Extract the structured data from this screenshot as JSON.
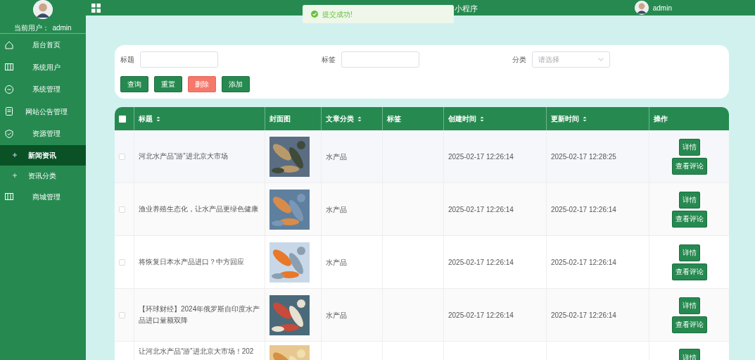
{
  "sidebar": {
    "user_label": "当前用户：",
    "user_name": "admin",
    "items": [
      {
        "label": "后台首页",
        "selected": false
      },
      {
        "label": "系统用户",
        "selected": false
      },
      {
        "label": "系统管理",
        "selected": false
      },
      {
        "label": "网站公告管理",
        "selected": false
      },
      {
        "label": "资源管理",
        "selected": false,
        "children": [
          {
            "label": "新闻资讯",
            "selected": true
          },
          {
            "label": "资讯分类",
            "selected": false
          }
        ]
      },
      {
        "label": "商城管理",
        "selected": false
      }
    ]
  },
  "header": {
    "title": "小程序",
    "user": "admin"
  },
  "toast": {
    "message": "提交成功!"
  },
  "search": {
    "fields": [
      {
        "label": "标题",
        "kind": "text"
      },
      {
        "label": "标签",
        "kind": "text"
      },
      {
        "label": "分类",
        "kind": "select",
        "placeholder": "请选择"
      }
    ],
    "buttons": [
      {
        "label": "查询",
        "kind": "primary"
      },
      {
        "label": "重置",
        "kind": "primary"
      },
      {
        "label": "删除",
        "kind": "danger"
      },
      {
        "label": "添加",
        "kind": "primary"
      }
    ]
  },
  "table": {
    "all_checked": false,
    "columns": [
      {
        "label": "标题",
        "sortable": true
      },
      {
        "label": "封面图",
        "sortable": false
      },
      {
        "label": "文章分类",
        "sortable": true
      },
      {
        "label": "标签",
        "sortable": false
      },
      {
        "label": "创建时间",
        "sortable": true
      },
      {
        "label": "更新时间",
        "sortable": true
      },
      {
        "label": "操作",
        "sortable": false
      }
    ],
    "rows": [
      {
        "checked": false,
        "title": "河北水产品“游”进北京大市场",
        "category": "水产品",
        "created": "2025-02-17 12:26:14",
        "updated": "2025-02-17 12:28:25",
        "actions": [
          "详情",
          "查看评论"
        ]
      },
      {
        "checked": false,
        "title": "渔业养殖生态化，让水产品更绿色健康",
        "category": "水产品",
        "created": "2025-02-17 12:26:14",
        "updated": "2025-02-17 12:26:14",
        "actions": [
          "详情",
          "查看评论"
        ]
      },
      {
        "checked": false,
        "title": "将恢复日本水产品进口？中方回应",
        "category": "水产品",
        "created": "2025-02-17 12:26:14",
        "updated": "2025-02-17 12:26:14",
        "actions": [
          "详情",
          "查看评论"
        ]
      },
      {
        "checked": false,
        "title": "【环球财经】2024年俄罗斯自印度水产品进口量额双降",
        "category": "水产品",
        "created": "2025-02-17 12:26:14",
        "updated": "2025-02-17 12:26:14",
        "actions": [
          "详情",
          "查看评论"
        ]
      },
      {
        "title": "让河北水产品“游”进北京大市场！202",
        "actions": [
          "详情"
        ]
      }
    ]
  }
}
